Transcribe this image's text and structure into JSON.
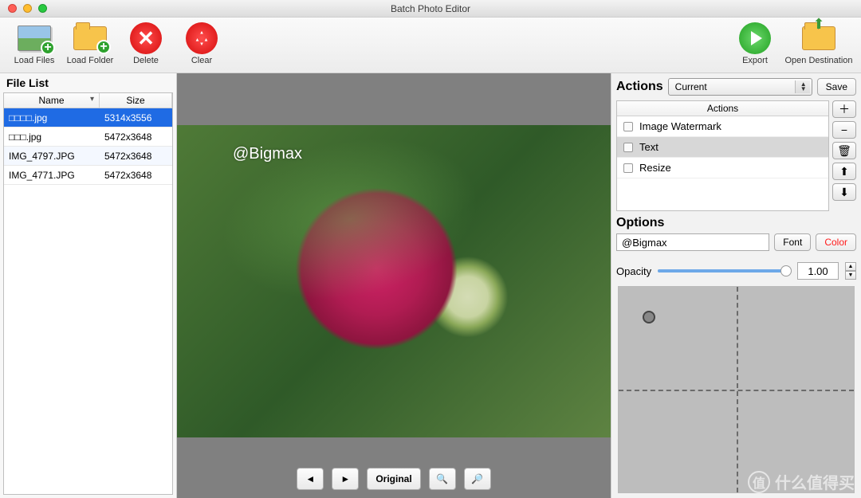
{
  "window": {
    "title": "Batch Photo Editor"
  },
  "toolbar": {
    "load_files": "Load Files",
    "load_folder": "Load Folder",
    "delete": "Delete",
    "clear": "Clear",
    "export": "Export",
    "open_dest": "Open Destination"
  },
  "file_list": {
    "title": "File List",
    "columns": {
      "name": "Name",
      "size": "Size"
    },
    "rows": [
      {
        "name": "□□□□.jpg",
        "size": "5314x3556",
        "selected": true
      },
      {
        "name": "□□□.jpg",
        "size": "5472x3648",
        "selected": false
      },
      {
        "name": "IMG_4797.JPG",
        "size": "5472x3648",
        "selected": false
      },
      {
        "name": "IMG_4771.JPG",
        "size": "5472x3648",
        "selected": false
      }
    ]
  },
  "preview": {
    "watermark_text": "@Bigmax",
    "buttons": {
      "prev": "←",
      "next": "→",
      "original": "Original",
      "zoom_in": "＋",
      "zoom_out": "－"
    }
  },
  "actions_panel": {
    "title": "Actions",
    "dropdown_value": "Current",
    "save_label": "Save",
    "list_header": "Actions",
    "items": [
      {
        "label": "Image Watermark",
        "selected": false
      },
      {
        "label": "Text",
        "selected": true
      },
      {
        "label": "Resize",
        "selected": false
      }
    ],
    "side_buttons": {
      "add": "＋",
      "remove": "−",
      "delete": "🗑",
      "up": "⬆",
      "down": "⬇"
    }
  },
  "options": {
    "title": "Options",
    "text_value": "@Bigmax",
    "font_label": "Font",
    "color_label": "Color",
    "opacity_label": "Opacity",
    "opacity_value": "1.00"
  },
  "corner_watermark": {
    "badge": "值",
    "text": "什么值得买"
  }
}
